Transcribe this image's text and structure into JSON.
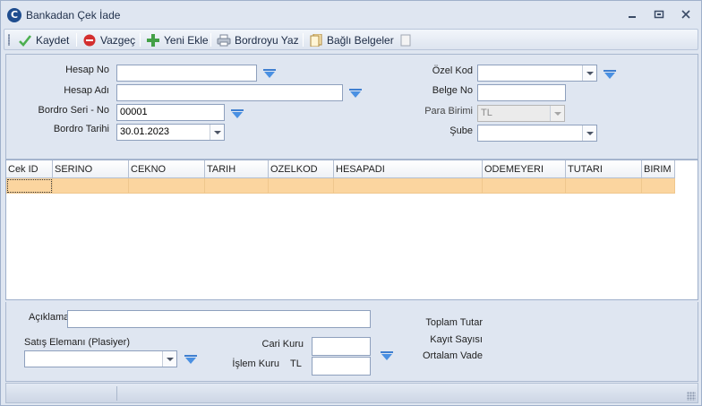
{
  "window": {
    "title": "Bankadan Çek İade",
    "app_icon_letter": "C",
    "minimize_icon": "minimize-icon",
    "maximize_icon": "maximize-icon",
    "close_icon": "close-icon"
  },
  "toolbar": {
    "save": "Kaydet",
    "cancel": "Vazgeç",
    "add_new": "Yeni Ekle",
    "print": "Bordroyu Yaz",
    "attachments": "Bağlı Belgeler"
  },
  "header": {
    "hesap_no_label": "Hesap No",
    "hesap_no_value": "",
    "hesap_adi_label": "Hesap Adı",
    "hesap_adi_value": "",
    "bordro_seri_label": "Bordro Seri - No",
    "bordro_seri_value": "00001",
    "bordro_tarihi_label": "Bordro Tarihi",
    "bordro_tarihi_value": "30.01.2023",
    "ozel_kod_label": "Özel Kod",
    "ozel_kod_value": "",
    "belge_no_label": "Belge No",
    "belge_no_value": "",
    "para_birimi_label": "Para Birimi",
    "para_birimi_value": "TL",
    "sube_label": "Şube",
    "sube_value": ""
  },
  "grid": {
    "columns": [
      "Cek ID",
      "SERINO",
      "CEKNO",
      "TARIH",
      "OZELKOD",
      "HESAPADI",
      "ODEMEYERI",
      "TUTARI",
      "BIRIM"
    ],
    "rows": [
      [
        "",
        "",
        "",
        "",
        "",
        "",
        "",
        "",
        ""
      ]
    ]
  },
  "footer": {
    "aciklama_label": "Açıklama",
    "aciklama_value": "",
    "plasiyer_label": "Satış Elemanı (Plasiyer)",
    "plasiyer_value": "",
    "cari_kuru_label": "Cari Kuru",
    "cari_kuru_value": "",
    "islem_kuru_label": "İşlem Kuru",
    "islem_kuru_currency": "TL",
    "islem_kuru_value": "",
    "toplam_tutar_label": "Toplam Tutar",
    "kayit_sayisi_label": "Kayıt Sayısı",
    "ortalam_vade_label": "Ortalam Vade"
  },
  "colors": {
    "window_bg": "#dfe6f1",
    "selected_row": "#fbd59f",
    "lookup_arrow": "#4a90e2",
    "save_icon": "#4caf50",
    "cancel_icon": "#d32f2f",
    "add_icon": "#43a047"
  }
}
